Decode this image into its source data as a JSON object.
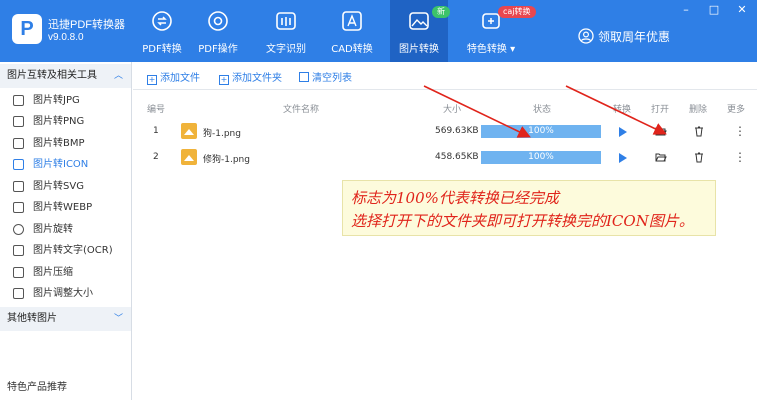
{
  "app": {
    "logo_letter": "P",
    "name": "迅捷PDF转换器",
    "version": "v9.0.8.0"
  },
  "nav": [
    {
      "label": "PDF转换"
    },
    {
      "label": "PDF操作"
    },
    {
      "label": "文字识别"
    },
    {
      "label": "CAD转换"
    },
    {
      "label": "图片转换",
      "badge": "新"
    },
    {
      "label": "特色转换 ▾",
      "badge": "caj转换"
    }
  ],
  "promo": {
    "label": "领取周年优惠"
  },
  "window": {
    "minimize": "–",
    "restore": "□",
    "close": "✕"
  },
  "sidebar": {
    "group1": {
      "title": "图片互转及相关工具",
      "chevron": "︿"
    },
    "items": [
      {
        "label": "图片转JPG"
      },
      {
        "label": "图片转PNG"
      },
      {
        "label": "图片转BMP"
      },
      {
        "label": "图片转ICON",
        "active": true
      },
      {
        "label": "图片转SVG"
      },
      {
        "label": "图片转WEBP"
      },
      {
        "label": "图片旋转"
      },
      {
        "label": "图片转文字(OCR)"
      },
      {
        "label": "图片压缩"
      },
      {
        "label": "图片调整大小"
      }
    ],
    "group2": {
      "title": "其他转图片",
      "chevron": "﹀"
    },
    "footer": "特色产品推荐"
  },
  "toolbar": {
    "add_file": "添加文件",
    "add_folder": "添加文件夹",
    "clear_list": "清空列表"
  },
  "table": {
    "headers": {
      "index": "编号",
      "name": "文件名称",
      "size": "大小",
      "status": "状态",
      "convert": "转换",
      "open": "打开",
      "delete": "删除",
      "more": "更多"
    },
    "rows": [
      {
        "index": "1",
        "name": "狗-1.png",
        "size": "569.63KB",
        "progress_label": "100%",
        "progress": 1.0
      },
      {
        "index": "2",
        "name": "修狗-1.png",
        "size": "458.65KB",
        "progress_label": "100%",
        "progress": 1.0
      }
    ]
  },
  "annotation": {
    "line1": "标志为100%代表转换已经完成",
    "line2": "选择打开下的文件夹即可打开转换完的ICON图片。"
  },
  "colors": {
    "accent": "#2f7fe6",
    "annotation_text": "#e0241b",
    "arrow": "#e0241b"
  }
}
